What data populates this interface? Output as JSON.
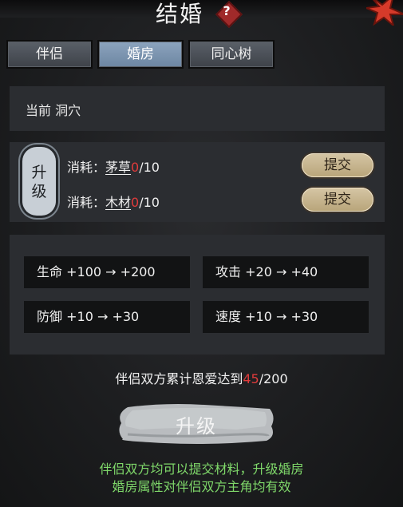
{
  "header": {
    "title": "结婚",
    "help_symbol": "?"
  },
  "tabs": [
    {
      "label": "伴侣",
      "active": false
    },
    {
      "label": "婚房",
      "active": true
    },
    {
      "label": "同心树",
      "active": false
    }
  ],
  "current_room": {
    "text": "当前 洞穴"
  },
  "upgrade_cost": {
    "badge_label": "升级",
    "rows": [
      {
        "prefix": "消耗：",
        "material": "茅草",
        "have": "0",
        "need": "/10",
        "button": "提交"
      },
      {
        "prefix": "消耗：",
        "material": "木材",
        "have": "0",
        "need": "/10",
        "button": "提交"
      }
    ]
  },
  "attributes": [
    {
      "name": "生命",
      "from": "+100",
      "arrow": "→",
      "to": "+200"
    },
    {
      "name": "攻击",
      "from": "+20",
      "arrow": "→",
      "to": "+40"
    },
    {
      "name": "防御",
      "from": "+10",
      "arrow": "→",
      "to": "+30"
    },
    {
      "name": "速度",
      "from": "+10",
      "arrow": "→",
      "to": "+30"
    }
  ],
  "progress": {
    "prefix": "伴侣双方累计恩爱达到",
    "current": "45",
    "target": "/200"
  },
  "upgrade_button": {
    "label": "升级"
  },
  "notes": [
    "伴侣双方均可以提交材料，升级婚房",
    "婚房属性对伴侣双方主角均有效"
  ],
  "colors": {
    "accent_red": "#e03b3b",
    "note_green": "#7fd86a",
    "active_tab": "#7f97b3"
  },
  "icons": {
    "help": "help-diamond-icon",
    "close": "close-icon"
  }
}
